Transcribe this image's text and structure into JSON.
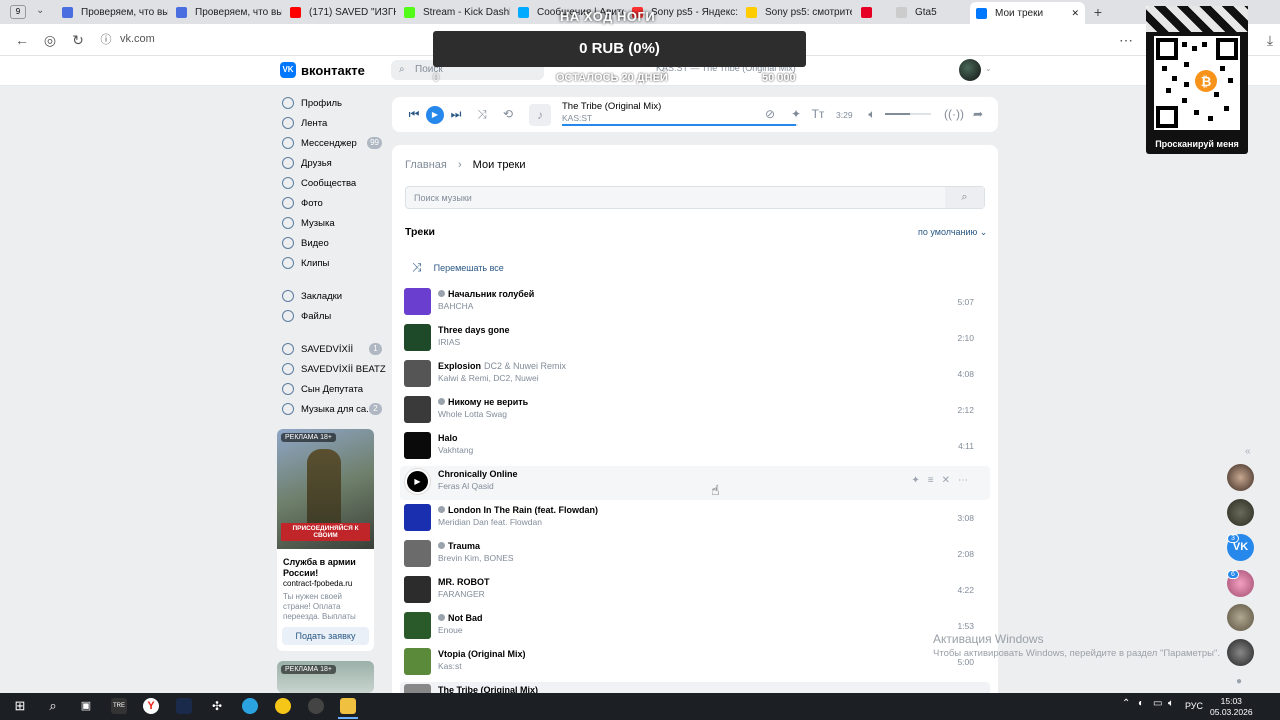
{
  "browser": {
    "tab_count": "9",
    "tabs": [
      {
        "label": "Проверяем, что вы н",
        "color": "#4a6ee0"
      },
      {
        "label": "Проверяем, что вы н",
        "color": "#4a6ee0"
      },
      {
        "label": "(171) SAVED \"ИЗГНА",
        "color": "#ff0000"
      },
      {
        "label": "Stream - Kick Dashbo",
        "color": "#53fc18"
      },
      {
        "label": "Сообщения | Авито",
        "color": "#00aaff"
      },
      {
        "label": "Sony ps5 - Яндекс:",
        "color": "#ff3333"
      },
      {
        "label": "Sony ps5: смотрите",
        "color": "#ffcc00"
      },
      {
        "label": "",
        "color": "#e60023"
      },
      {
        "label": "Gta5",
        "color": "#cccccc"
      },
      {
        "label": "Мои треки",
        "color": "#0077ff"
      }
    ],
    "url": "vk.com"
  },
  "overlay": {
    "title": "НА ХОД НОГИ",
    "amount": "0 RUB (0%)",
    "start": "0",
    "subtitle": "ОСТАЛОСЬ 20 ДНЕЙ",
    "goal": "50 000",
    "qr_label": "Просканируй меня"
  },
  "header": {
    "logo": "вконтакте",
    "logo_mark": "VK",
    "search_placeholder": "Поиск",
    "now_playing": "KAS:ST — The Tribe (Original Mix)"
  },
  "sidebar": {
    "items": [
      {
        "label": "Профиль"
      },
      {
        "label": "Лента"
      },
      {
        "label": "Мессенджер",
        "badge": "99"
      },
      {
        "label": "Друзья"
      },
      {
        "label": "Сообщества"
      },
      {
        "label": "Фото"
      },
      {
        "label": "Музыка"
      },
      {
        "label": "Видео"
      },
      {
        "label": "Клипы"
      }
    ],
    "items2": [
      {
        "label": "Закладки"
      },
      {
        "label": "Файлы"
      }
    ],
    "groups": [
      {
        "label": "SAVEDVİXİİ",
        "badge": "1"
      },
      {
        "label": "SAVEDVİXİİ BEATZ",
        "badge": ""
      },
      {
        "label": "Сын Депутата",
        "badge": ""
      },
      {
        "label": "Музыка для са...",
        "badge": "2"
      }
    ],
    "ad": {
      "tag": "РЕКЛАМА 18+",
      "image_text": "ПРИСОЕДИНЯЙСЯ К СВОИМ",
      "title": "Служба в армии России!",
      "domain": "contract-fpobeda.ru",
      "text": "Ты нужен своей стране! Оплата переезда. Выплаты",
      "button": "Подать заявку"
    },
    "ad2_tag": "РЕКЛАМА 18+"
  },
  "player": {
    "title": "The Tribe (Original Mix)",
    "artist": "KAS:ST",
    "time": "3:29",
    "progress": 0.99,
    "volume": 0.55
  },
  "main": {
    "breadcrumb_home": "Главная",
    "breadcrumb_sep": "›",
    "breadcrumb_current": "Мои треки",
    "search_placeholder": "Поиск музыки",
    "tracks_heading": "Треки",
    "sort_label": "по умолчанию",
    "shuffle_label": "Перемешать все",
    "tracks": [
      {
        "title": "Начальник голубей",
        "sub": "",
        "artist": "BAHCHA",
        "duration": "5:07",
        "explicit": true,
        "cover": "#6a3fd0"
      },
      {
        "title": "Three days gone",
        "sub": "",
        "artist": "IRIAS",
        "duration": "2:10",
        "explicit": false,
        "cover": "#1f4a2a"
      },
      {
        "title": "Explosion",
        "sub": "DC2 & Nuwei Remix",
        "artist": "Kalwi & Remi, DC2, Nuwei",
        "duration": "4:08",
        "explicit": false,
        "cover": "#555555"
      },
      {
        "title": "Никому не верить",
        "sub": "",
        "artist": "Whole Lotta Swag",
        "duration": "2:12",
        "explicit": true,
        "cover": "#3a3a3a"
      },
      {
        "title": "Halo",
        "sub": "",
        "artist": "Vakhtang",
        "duration": "4:11",
        "explicit": false,
        "cover": "#0a0a0a"
      },
      {
        "title": "Chronically Online",
        "sub": "",
        "artist": "Feras Al Qasid",
        "duration": "",
        "explicit": false,
        "cover": "#ffffff",
        "hover": true
      },
      {
        "title": "London In The Rain (feat. Flowdan)",
        "sub": "",
        "artist": "Meridian Dan feat. Flowdan",
        "duration": "3:08",
        "explicit": true,
        "cover": "#1a2fb0"
      },
      {
        "title": "Trauma",
        "sub": "",
        "artist": "Brevin Kim, BONES",
        "duration": "2:08",
        "explicit": true,
        "cover": "#6b6b6b"
      },
      {
        "title": "MR. ROBOT",
        "sub": "",
        "artist": "FARANGER",
        "duration": "4:22",
        "explicit": false,
        "cover": "#2c2c2c"
      },
      {
        "title": "Not Bad",
        "sub": "",
        "artist": "Enoue",
        "duration": "1:53",
        "explicit": true,
        "cover": "#2a5a2a"
      },
      {
        "title": "Vtopia (Original Mix)",
        "sub": "",
        "artist": "Kas:st",
        "duration": "5:00",
        "explicit": false,
        "cover": "#5a8a3a"
      },
      {
        "title": "The Tribe (Original Mix)",
        "sub": "",
        "artist": "",
        "duration": "",
        "explicit": false,
        "cover": "#888888",
        "active": true
      }
    ]
  },
  "right_rail": {
    "badges": [
      "3",
      "6"
    ]
  },
  "windows": {
    "activate_title": "Активация Windows",
    "activate_text": "Чтобы активировать Windows, перейдите в раздел \"Параметры\"."
  },
  "taskbar": {
    "lang": "РУС",
    "time": "15:03",
    "date": "05.03.2026"
  }
}
